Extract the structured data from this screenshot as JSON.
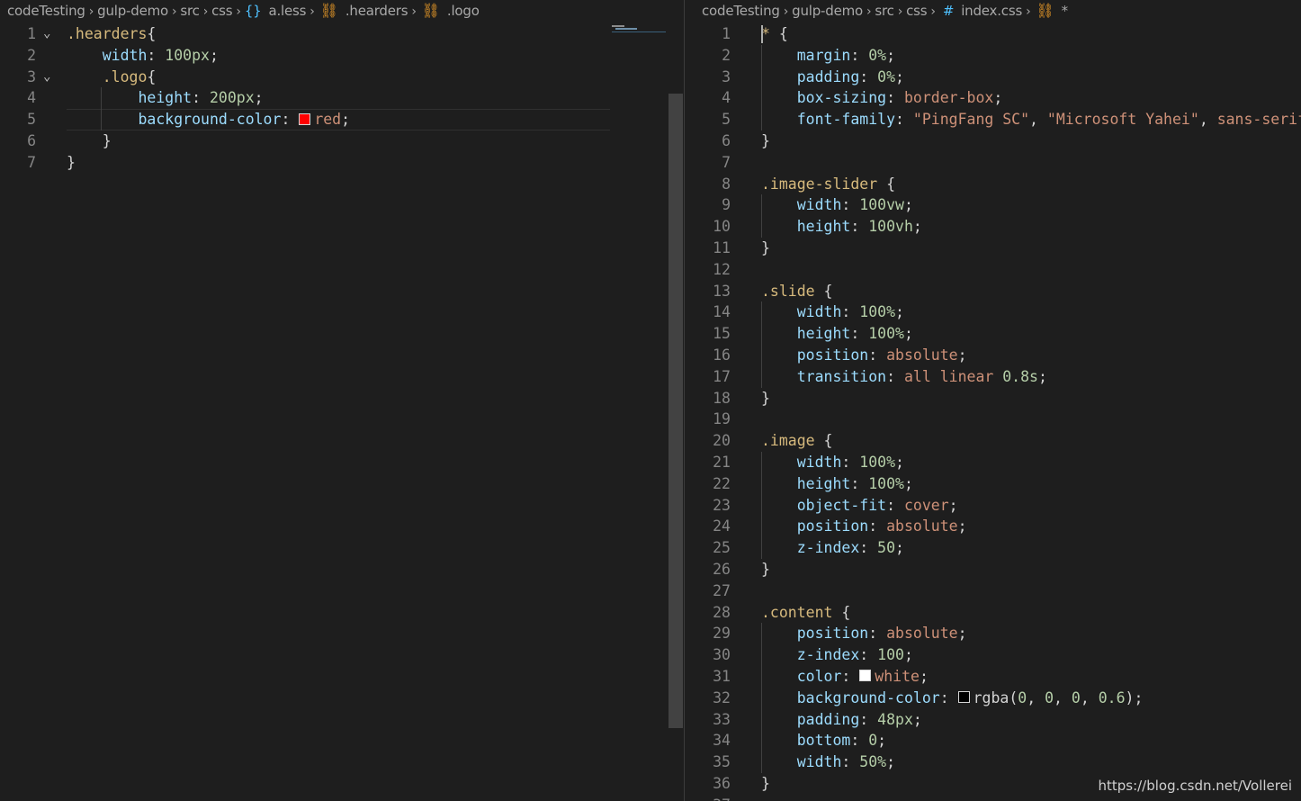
{
  "left_editor": {
    "breadcrumb": [
      "codeTesting",
      "gulp-demo",
      "src",
      "css",
      "a.less",
      ".hearders",
      ".logo"
    ],
    "lines": [
      {
        "num": "1",
        "tokens": [
          [
            ".hearders",
            "sel"
          ],
          [
            "{",
            "pun"
          ]
        ]
      },
      {
        "num": "2",
        "tokens": [
          [
            "    ",
            "pun"
          ],
          [
            "width",
            "prop"
          ],
          [
            ": ",
            "pun"
          ],
          [
            "100px",
            "num"
          ],
          [
            ";",
            "pun"
          ]
        ]
      },
      {
        "num": "3",
        "tokens": [
          [
            "    ",
            "pun"
          ],
          [
            ".logo",
            "sel"
          ],
          [
            "{",
            "pun"
          ]
        ]
      },
      {
        "num": "4",
        "tokens": [
          [
            "        ",
            "pun"
          ],
          [
            "height",
            "prop"
          ],
          [
            ": ",
            "pun"
          ],
          [
            "200px",
            "num"
          ],
          [
            ";",
            "pun"
          ]
        ]
      },
      {
        "num": "5",
        "tokens": [
          [
            "        ",
            "pun"
          ],
          [
            "background-color",
            "prop"
          ],
          [
            ": ",
            "pun"
          ],
          [
            "red",
            "kw"
          ],
          [
            ";",
            "pun"
          ]
        ]
      },
      {
        "num": "6",
        "tokens": [
          [
            "    ",
            "pun"
          ],
          [
            "}",
            "pun"
          ]
        ]
      },
      {
        "num": "7",
        "tokens": [
          [
            "}",
            "pun"
          ]
        ]
      }
    ],
    "red_swatch_color": "#ff0000"
  },
  "right_editor": {
    "breadcrumb": [
      "codeTesting",
      "gulp-demo",
      "src",
      "css",
      "index.css",
      "*"
    ],
    "lines": [
      {
        "num": "1",
        "tokens": [
          [
            "* ",
            "sel"
          ],
          [
            "{",
            "pun"
          ]
        ]
      },
      {
        "num": "2",
        "tokens": [
          [
            "    ",
            "pun"
          ],
          [
            "margin",
            "prop"
          ],
          [
            ": ",
            "pun"
          ],
          [
            "0%",
            "num"
          ],
          [
            ";",
            "pun"
          ]
        ]
      },
      {
        "num": "3",
        "tokens": [
          [
            "    ",
            "pun"
          ],
          [
            "padding",
            "prop"
          ],
          [
            ": ",
            "pun"
          ],
          [
            "0%",
            "num"
          ],
          [
            ";",
            "pun"
          ]
        ]
      },
      {
        "num": "4",
        "tokens": [
          [
            "    ",
            "pun"
          ],
          [
            "box-sizing",
            "prop"
          ],
          [
            ": ",
            "pun"
          ],
          [
            "border-box",
            "kw"
          ],
          [
            ";",
            "pun"
          ]
        ]
      },
      {
        "num": "5",
        "tokens": [
          [
            "    ",
            "pun"
          ],
          [
            "font-family",
            "prop"
          ],
          [
            ": ",
            "pun"
          ],
          [
            "\"PingFang SC\"",
            "str"
          ],
          [
            ", ",
            "pun"
          ],
          [
            "\"Microsoft Yahei\"",
            "str"
          ],
          [
            ", ",
            "pun"
          ],
          [
            "sans-serif",
            "kw"
          ],
          [
            ";",
            "pun"
          ]
        ]
      },
      {
        "num": "6",
        "tokens": [
          [
            "}",
            "pun"
          ]
        ]
      },
      {
        "num": "7",
        "tokens": []
      },
      {
        "num": "8",
        "tokens": [
          [
            ".image-slider",
            "sel"
          ],
          [
            " {",
            "pun"
          ]
        ]
      },
      {
        "num": "9",
        "tokens": [
          [
            "    ",
            "pun"
          ],
          [
            "width",
            "prop"
          ],
          [
            ": ",
            "pun"
          ],
          [
            "100vw",
            "num"
          ],
          [
            ";",
            "pun"
          ]
        ]
      },
      {
        "num": "10",
        "tokens": [
          [
            "    ",
            "pun"
          ],
          [
            "height",
            "prop"
          ],
          [
            ": ",
            "pun"
          ],
          [
            "100vh",
            "num"
          ],
          [
            ";",
            "pun"
          ]
        ]
      },
      {
        "num": "11",
        "tokens": [
          [
            "}",
            "pun"
          ]
        ]
      },
      {
        "num": "12",
        "tokens": []
      },
      {
        "num": "13",
        "tokens": [
          [
            ".slide",
            "sel"
          ],
          [
            " {",
            "pun"
          ]
        ]
      },
      {
        "num": "14",
        "tokens": [
          [
            "    ",
            "pun"
          ],
          [
            "width",
            "prop"
          ],
          [
            ": ",
            "pun"
          ],
          [
            "100%",
            "num"
          ],
          [
            ";",
            "pun"
          ]
        ]
      },
      {
        "num": "15",
        "tokens": [
          [
            "    ",
            "pun"
          ],
          [
            "height",
            "prop"
          ],
          [
            ": ",
            "pun"
          ],
          [
            "100%",
            "num"
          ],
          [
            ";",
            "pun"
          ]
        ]
      },
      {
        "num": "16",
        "tokens": [
          [
            "    ",
            "pun"
          ],
          [
            "position",
            "prop"
          ],
          [
            ": ",
            "pun"
          ],
          [
            "absolute",
            "kw"
          ],
          [
            ";",
            "pun"
          ]
        ]
      },
      {
        "num": "17",
        "tokens": [
          [
            "    ",
            "pun"
          ],
          [
            "transition",
            "prop"
          ],
          [
            ": ",
            "pun"
          ],
          [
            "all linear ",
            "kw"
          ],
          [
            "0.8s",
            "num"
          ],
          [
            ";",
            "pun"
          ]
        ]
      },
      {
        "num": "18",
        "tokens": [
          [
            "}",
            "pun"
          ]
        ]
      },
      {
        "num": "19",
        "tokens": []
      },
      {
        "num": "20",
        "tokens": [
          [
            ".image",
            "sel"
          ],
          [
            " {",
            "pun"
          ]
        ]
      },
      {
        "num": "21",
        "tokens": [
          [
            "    ",
            "pun"
          ],
          [
            "width",
            "prop"
          ],
          [
            ": ",
            "pun"
          ],
          [
            "100%",
            "num"
          ],
          [
            ";",
            "pun"
          ]
        ]
      },
      {
        "num": "22",
        "tokens": [
          [
            "    ",
            "pun"
          ],
          [
            "height",
            "prop"
          ],
          [
            ": ",
            "pun"
          ],
          [
            "100%",
            "num"
          ],
          [
            ";",
            "pun"
          ]
        ]
      },
      {
        "num": "23",
        "tokens": [
          [
            "    ",
            "pun"
          ],
          [
            "object-fit",
            "prop"
          ],
          [
            ": ",
            "pun"
          ],
          [
            "cover",
            "kw"
          ],
          [
            ";",
            "pun"
          ]
        ]
      },
      {
        "num": "24",
        "tokens": [
          [
            "    ",
            "pun"
          ],
          [
            "position",
            "prop"
          ],
          [
            ": ",
            "pun"
          ],
          [
            "absolute",
            "kw"
          ],
          [
            ";",
            "pun"
          ]
        ]
      },
      {
        "num": "25",
        "tokens": [
          [
            "    ",
            "pun"
          ],
          [
            "z-index",
            "prop"
          ],
          [
            ": ",
            "pun"
          ],
          [
            "50",
            "num"
          ],
          [
            ";",
            "pun"
          ]
        ]
      },
      {
        "num": "26",
        "tokens": [
          [
            "}",
            "pun"
          ]
        ]
      },
      {
        "num": "27",
        "tokens": []
      },
      {
        "num": "28",
        "tokens": [
          [
            ".content",
            "sel"
          ],
          [
            " {",
            "pun"
          ]
        ]
      },
      {
        "num": "29",
        "tokens": [
          [
            "    ",
            "pun"
          ],
          [
            "position",
            "prop"
          ],
          [
            ": ",
            "pun"
          ],
          [
            "absolute",
            "kw"
          ],
          [
            ";",
            "pun"
          ]
        ]
      },
      {
        "num": "30",
        "tokens": [
          [
            "    ",
            "pun"
          ],
          [
            "z-index",
            "prop"
          ],
          [
            ": ",
            "pun"
          ],
          [
            "100",
            "num"
          ],
          [
            ";",
            "pun"
          ]
        ]
      },
      {
        "num": "31",
        "tokens": [
          [
            "    ",
            "pun"
          ],
          [
            "color",
            "prop"
          ],
          [
            ": ",
            "pun"
          ],
          [
            "@swatch:#ffffff",
            "sw"
          ],
          [
            "white",
            "kw"
          ],
          [
            ";",
            "pun"
          ]
        ]
      },
      {
        "num": "32",
        "tokens": [
          [
            "    ",
            "pun"
          ],
          [
            "background-color",
            "prop"
          ],
          [
            ": ",
            "pun"
          ],
          [
            "@swatch:#000000",
            "sw"
          ],
          [
            "rgba",
            "pun"
          ],
          [
            "(",
            "pun"
          ],
          [
            "0",
            "num"
          ],
          [
            ", ",
            "pun"
          ],
          [
            "0",
            "num"
          ],
          [
            ", ",
            "pun"
          ],
          [
            "0",
            "num"
          ],
          [
            ", ",
            "pun"
          ],
          [
            "0.6",
            "num"
          ],
          [
            ");",
            "pun"
          ]
        ]
      },
      {
        "num": "33",
        "tokens": [
          [
            "    ",
            "pun"
          ],
          [
            "padding",
            "prop"
          ],
          [
            ": ",
            "pun"
          ],
          [
            "48px",
            "num"
          ],
          [
            ";",
            "pun"
          ]
        ]
      },
      {
        "num": "34",
        "tokens": [
          [
            "    ",
            "pun"
          ],
          [
            "bottom",
            "prop"
          ],
          [
            ": ",
            "pun"
          ],
          [
            "0",
            "num"
          ],
          [
            ";",
            "pun"
          ]
        ]
      },
      {
        "num": "35",
        "tokens": [
          [
            "    ",
            "pun"
          ],
          [
            "width",
            "prop"
          ],
          [
            ": ",
            "pun"
          ],
          [
            "50%",
            "num"
          ],
          [
            ";",
            "pun"
          ]
        ]
      },
      {
        "num": "36",
        "tokens": [
          [
            "}",
            "pun"
          ]
        ]
      },
      {
        "num": "37",
        "tokens": []
      }
    ]
  },
  "watermark": "https://blog.csdn.net/Vollerei",
  "colors": {
    "editor_bg": "#1e1e1e",
    "selector": "#d7ba7d",
    "property": "#9cdcfe",
    "number": "#b5cea8",
    "string": "#ce9178",
    "line_number": "#858585"
  }
}
